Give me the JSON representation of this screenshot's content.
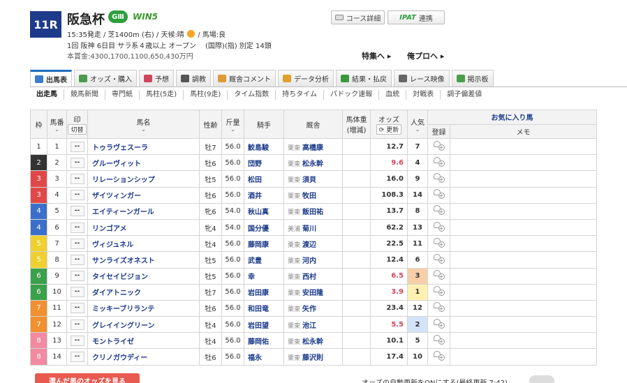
{
  "race": {
    "number": "11R",
    "name": "阪急杯",
    "grade": "GⅢ",
    "win5": "WIN5",
    "info1_pre": "15:35発走 / 芝1400m (右) / 天候:晴",
    "info1_post": "/ 馬場:良",
    "info2": "1回 阪神 6日目 サラ系４歳以上 オープン 　(国際)(指) 別定 14頭",
    "info3": "本賞金:4300,1700,1100,650,430万円"
  },
  "buttons": {
    "course": "コース詳細",
    "ipat_mark": "IPAT",
    "ipat": "連携"
  },
  "links": {
    "feature": "特集へ ▸",
    "pro": "俺プロへ ▸"
  },
  "main_tabs": [
    {
      "label": "出馬表",
      "color": "#3b7bd1"
    },
    {
      "label": "オッズ・購入",
      "color": "#4c9a4c"
    },
    {
      "label": "予想",
      "color": "#d0455a"
    },
    {
      "label": "調教",
      "color": "#555555"
    },
    {
      "label": "厩舎コメント",
      "color": "#e09a3a"
    },
    {
      "label": "データ分析",
      "color": "#e0a02a"
    },
    {
      "label": "結果・払戻",
      "color": "#3a9a3a"
    },
    {
      "label": "レース映像",
      "color": "#666666"
    },
    {
      "label": "掲示板",
      "color": "#4aa04a"
    }
  ],
  "sub_tabs": [
    "出走馬",
    "競馬新聞",
    "専門紙",
    "馬柱(5走)",
    "馬柱(9走)",
    "タイム指数",
    "持ちタイム",
    "パドック速報",
    "血統",
    "対戦表",
    "調子偏差値"
  ],
  "headers": {
    "waku": "枠",
    "umaban": "馬番",
    "mark": "印",
    "cut": "切替",
    "horse": "馬名",
    "sex": "性齢",
    "weight": "斤量",
    "jockey": "騎手",
    "trainer": "厩舎",
    "body": "馬体重",
    "body_sub": "(増減)",
    "odds": "オッズ",
    "update": "更新",
    "pop": "人気",
    "fav": "お気に入り馬",
    "reg": "登録",
    "memo": "メモ"
  },
  "mark_placeholder": "--",
  "waku_colors": {
    "1": {
      "bg": "#ffffff",
      "fg": "#333333"
    },
    "2": {
      "bg": "#333333",
      "fg": "#ffffff"
    },
    "3": {
      "bg": "#e04848",
      "fg": "#ffffff"
    },
    "4": {
      "bg": "#3b6fc9",
      "fg": "#ffffff"
    },
    "5": {
      "bg": "#f0d030",
      "fg": "#ffffff"
    },
    "6": {
      "bg": "#3aa04a",
      "fg": "#ffffff"
    },
    "7": {
      "bg": "#f09030",
      "fg": "#ffffff"
    },
    "8": {
      "bg": "#f08aa0",
      "fg": "#ffffff"
    }
  },
  "pop_colors": {
    "1": "#fff2b0",
    "2": "#d4e4f8",
    "3": "#f6cfa8"
  },
  "horses": [
    {
      "waku": "1",
      "umaban": "1",
      "name": "トゥラヴェスーラ",
      "sex": "牡7",
      "weight": "56.0",
      "jockey": "鮫島駿",
      "region": "栗東",
      "trainer": "高橋康",
      "odds": "12.7",
      "pop": "7"
    },
    {
      "waku": "2",
      "umaban": "2",
      "name": "グルーヴィット",
      "sex": "牡6",
      "weight": "56.0",
      "jockey": "団野",
      "region": "栗東",
      "trainer": "松永幹",
      "odds": "9.6",
      "pop": "4"
    },
    {
      "waku": "3",
      "umaban": "3",
      "name": "リレーションシップ",
      "sex": "牡5",
      "weight": "56.0",
      "jockey": "松田",
      "region": "栗東",
      "trainer": "須貝",
      "odds": "16.0",
      "pop": "9"
    },
    {
      "waku": "3",
      "umaban": "4",
      "name": "ザイツィンガー",
      "sex": "牡6",
      "weight": "56.0",
      "jockey": "酒井",
      "region": "栗東",
      "trainer": "牧田",
      "odds": "108.3",
      "pop": "14"
    },
    {
      "waku": "4",
      "umaban": "5",
      "name": "エイティーンガール",
      "sex": "牝6",
      "weight": "54.0",
      "jockey": "秋山真",
      "region": "栗東",
      "trainer": "飯田祐",
      "odds": "13.7",
      "pop": "8"
    },
    {
      "waku": "4",
      "umaban": "6",
      "name": "リンゴアメ",
      "sex": "牝4",
      "weight": "54.0",
      "jockey": "国分優",
      "region": "美浦",
      "trainer": "菊川",
      "odds": "62.2",
      "pop": "13"
    },
    {
      "waku": "5",
      "umaban": "7",
      "name": "ヴィジュネル",
      "sex": "牡4",
      "weight": "56.0",
      "jockey": "藤岡康",
      "region": "栗東",
      "trainer": "渡辺",
      "odds": "22.5",
      "pop": "11"
    },
    {
      "waku": "5",
      "umaban": "8",
      "name": "サンライズオネスト",
      "sex": "牡5",
      "weight": "56.0",
      "jockey": "武豊",
      "region": "栗東",
      "trainer": "河内",
      "odds": "12.4",
      "pop": "6"
    },
    {
      "waku": "6",
      "umaban": "9",
      "name": "タイセイビジョン",
      "sex": "牡5",
      "weight": "56.0",
      "jockey": "幸",
      "region": "栗東",
      "trainer": "西村",
      "odds": "6.5",
      "pop": "3"
    },
    {
      "waku": "6",
      "umaban": "10",
      "name": "ダイアトニック",
      "sex": "牡7",
      "weight": "56.0",
      "jockey": "岩田康",
      "region": "栗東",
      "trainer": "安田隆",
      "odds": "3.9",
      "pop": "1"
    },
    {
      "waku": "7",
      "umaban": "11",
      "name": "ミッキーブリランテ",
      "sex": "牡6",
      "weight": "56.0",
      "jockey": "和田竜",
      "region": "栗東",
      "trainer": "矢作",
      "odds": "23.4",
      "pop": "12"
    },
    {
      "waku": "7",
      "umaban": "12",
      "name": "グレイイングリーン",
      "sex": "牡4",
      "weight": "56.0",
      "jockey": "岩田望",
      "region": "栗東",
      "trainer": "池江",
      "odds": "5.5",
      "pop": "2"
    },
    {
      "waku": "8",
      "umaban": "13",
      "name": "モントライゼ",
      "sex": "牡4",
      "weight": "56.0",
      "jockey": "藤岡佑",
      "region": "栗東",
      "trainer": "松永幹",
      "odds": "10.1",
      "pop": "5"
    },
    {
      "waku": "8",
      "umaban": "14",
      "name": "クリノガウディー",
      "sex": "牡6",
      "weight": "56.0",
      "jockey": "福永",
      "region": "栗東",
      "trainer": "藤沢則",
      "odds": "17.4",
      "pop": "10"
    }
  ],
  "bottom": {
    "banner": "選んだ馬のオッズを見る",
    "auto_update": "オッズの自動更新をONにする(最終更新 7:42)"
  }
}
